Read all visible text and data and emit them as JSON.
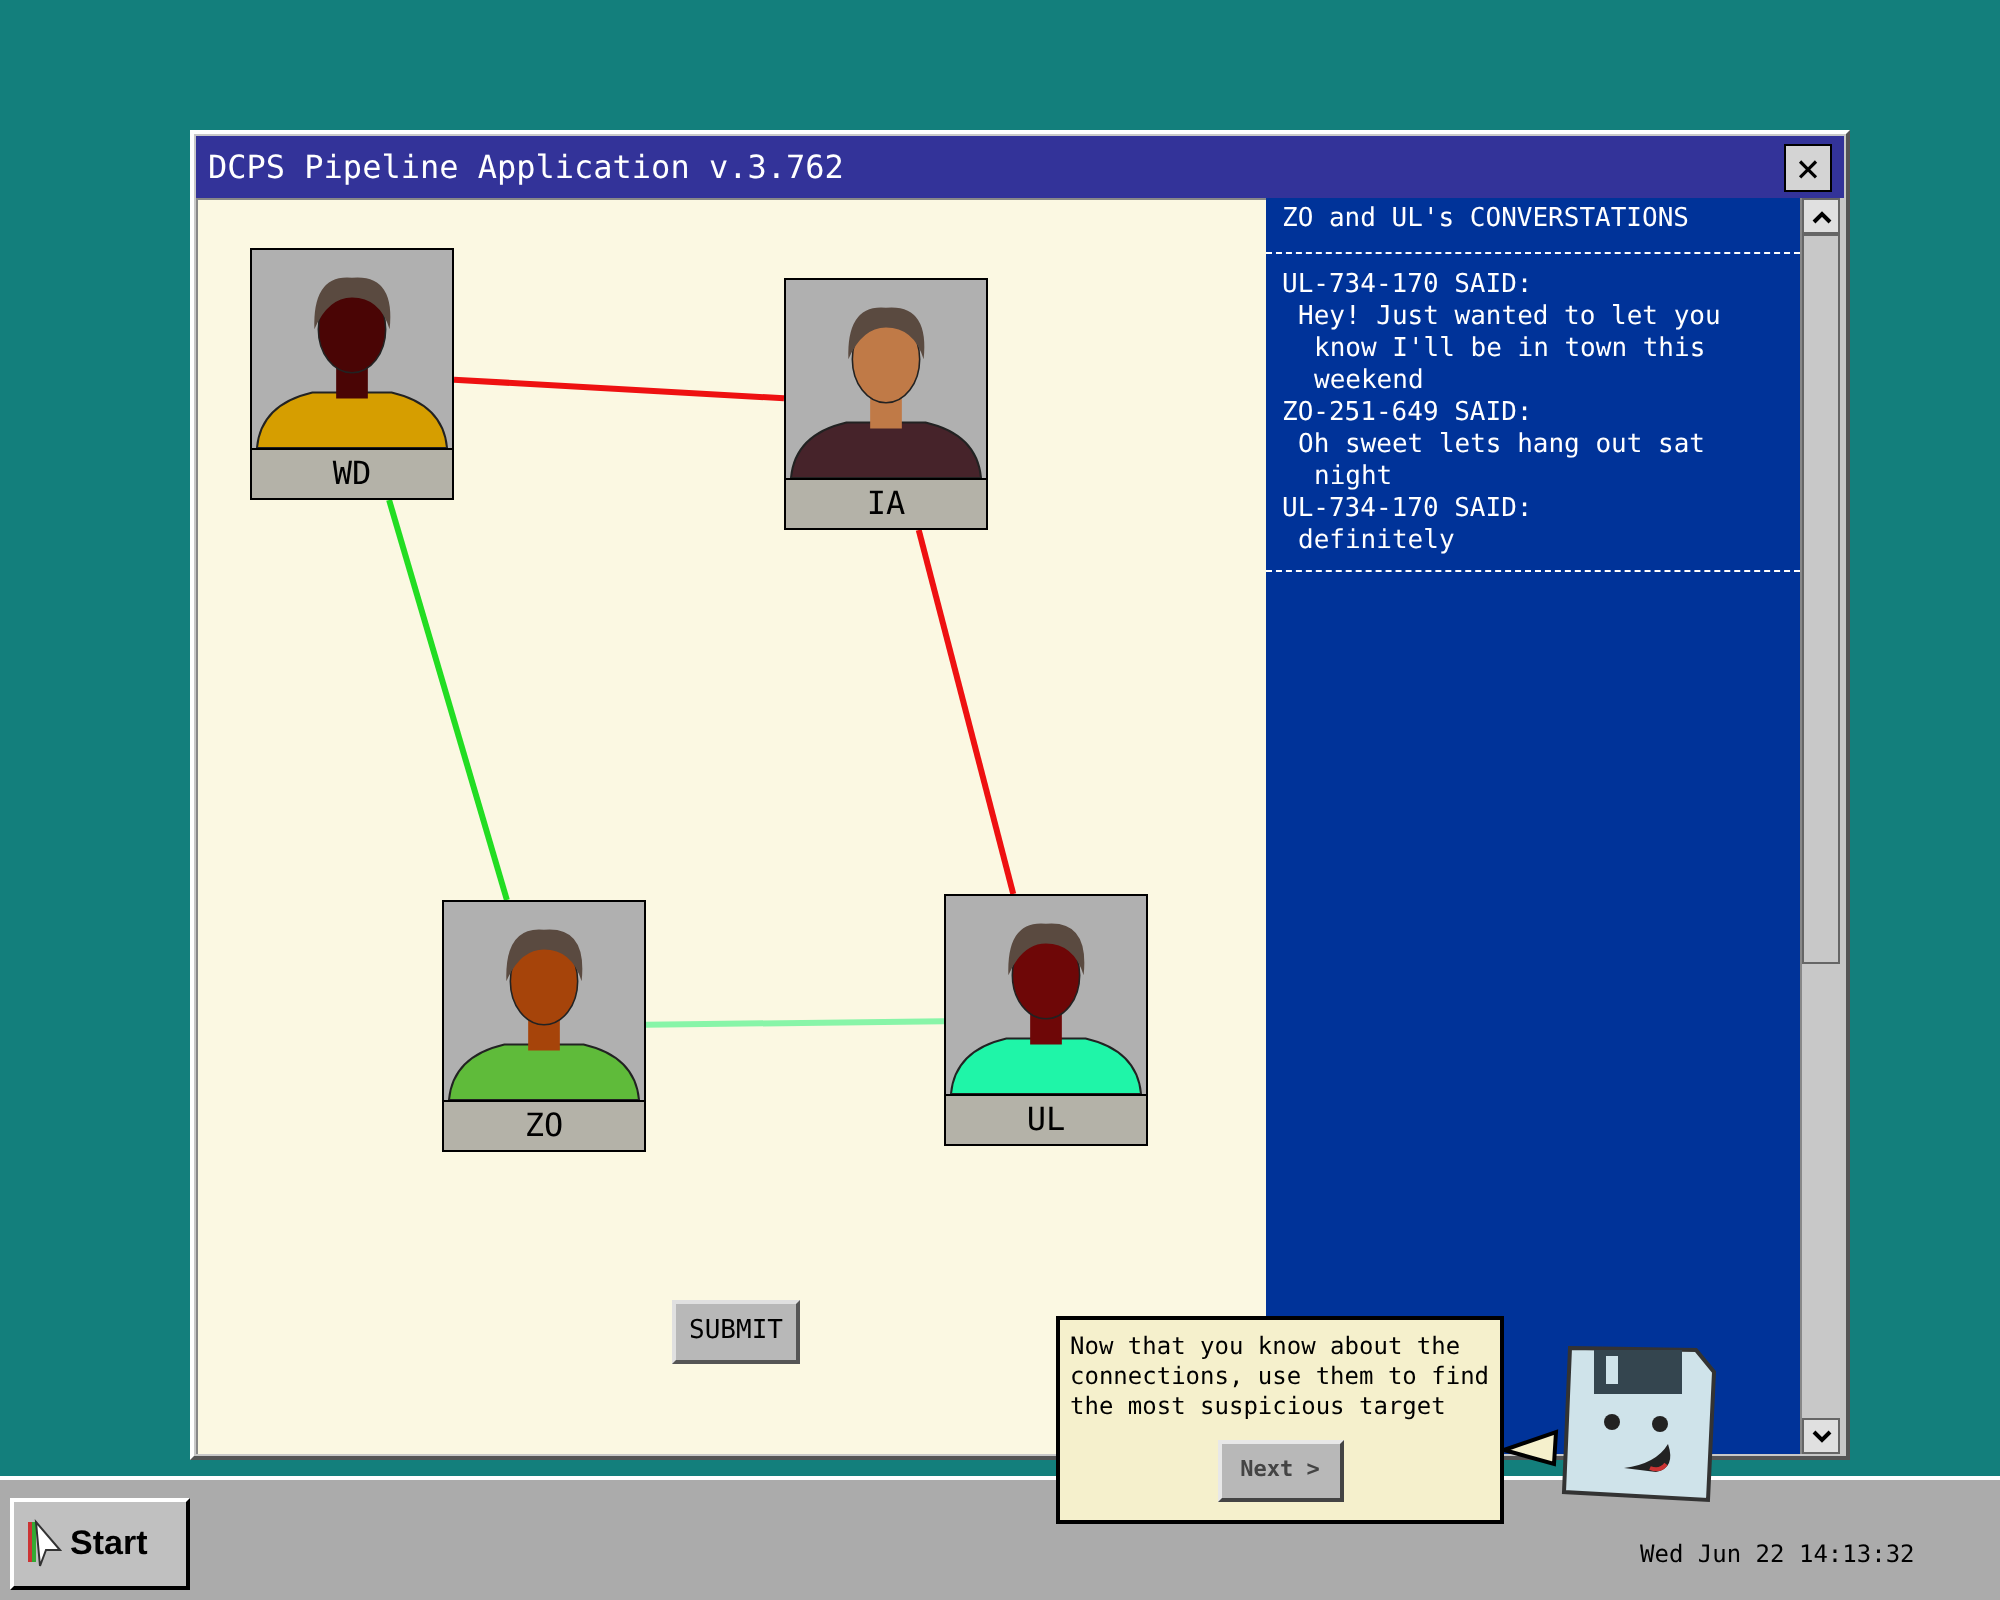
{
  "window": {
    "title": "DCPS Pipeline Application v.3.762",
    "close_label": "×"
  },
  "graph": {
    "nodes": [
      {
        "label": "WD",
        "color": "#d69e00"
      },
      {
        "label": "IA",
        "color": "#46232a"
      },
      {
        "label": "ZO",
        "color": "#5fbb3a"
      },
      {
        "label": "UL",
        "color": "#1ff5a8"
      }
    ],
    "edges": [
      {
        "color": "#ee1111"
      },
      {
        "color": "#ee1111"
      },
      {
        "color": "#22dd22"
      },
      {
        "color": "#88f5a8"
      }
    ]
  },
  "submit_button": "SUBMIT",
  "conversation": {
    "title": "ZO and UL's CONVERSTATIONS",
    "messages": [
      {
        "speaker": "UL-734-170 SAID:",
        "lines": [
          "Hey! Just wanted to let you",
          "know I'll be in town this",
          "weekend"
        ]
      },
      {
        "speaker": "ZO-251-649 SAID:",
        "lines": [
          "Oh sweet lets hang out sat",
          "night"
        ]
      },
      {
        "speaker": "UL-734-170 SAID:",
        "lines": [
          "definitely"
        ]
      }
    ]
  },
  "tooltip": {
    "text": "Now that you know about the connections, use them to find the most suspicious target",
    "button": "Next >"
  },
  "taskbar": {
    "start": "Start",
    "clock": "Wed Jun 22 14:13:32"
  }
}
